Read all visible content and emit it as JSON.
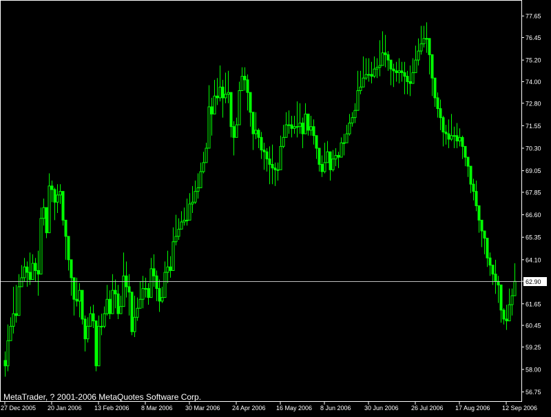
{
  "colors": {
    "background": "#000000",
    "frame": "#ffffff",
    "candle": "#00ff00",
    "text": "#ffffff",
    "current_price_line": "#c0c0c0",
    "current_price_tag_bg": "#ffffff",
    "current_price_tag_text": "#000000"
  },
  "footer": {
    "copyright": "MetaTrader, ? 2001-2006 MetaQuotes Software Corp."
  },
  "chart_data": {
    "type": "candlestick",
    "grid": false,
    "ylim": [
      56.2,
      78.5
    ],
    "y_ticks": [
      "77.65",
      "76.45",
      "75.20",
      "74.00",
      "72.80",
      "71.55",
      "70.30",
      "69.05",
      "67.85",
      "66.60",
      "65.35",
      "64.10",
      "62.90",
      "61.65",
      "60.45",
      "59.25",
      "58.00",
      "56.75"
    ],
    "x_ticks": [
      {
        "label": "27 Dec 2005",
        "index": 0
      },
      {
        "label": "20 Jan 2006",
        "index": 17
      },
      {
        "label": "13 Feb 2006",
        "index": 34
      },
      {
        "label": "8 Mar 2006",
        "index": 51
      },
      {
        "label": "30 Mar 2006",
        "index": 67
      },
      {
        "label": "24 Apr 2006",
        "index": 84
      },
      {
        "label": "16 May 2006",
        "index": 100
      },
      {
        "label": "8 Jun 2006",
        "index": 116
      },
      {
        "label": "30 Jun 2006",
        "index": 132
      },
      {
        "label": "26 Jul 2006",
        "index": 149
      },
      {
        "label": "17 Aug 2006",
        "index": 165
      },
      {
        "label": "12 Sep 2006",
        "index": 182
      }
    ],
    "current_price": "62.90",
    "series": [
      {
        "close": [
          58.2,
          59.6,
          60.4,
          61.1,
          61.0,
          62.6,
          63.1,
          63.7,
          63.4,
          63.0,
          63.9,
          63.5,
          63.3,
          66.4,
          67.0,
          65.6,
          68.2,
          68.0,
          67.3,
          67.7,
          67.9,
          66.3,
          65.4,
          64.1,
          63.1,
          61.9,
          61.8,
          62.4,
          60.8,
          59.7,
          60.4,
          61.1,
          60.7,
          58.2,
          60.4,
          60.4,
          61.1,
          61.9,
          61.1,
          62.4,
          62.2,
          61.1,
          61.5,
          63.2,
          62.6,
          62.3,
          60.1,
          60.9,
          61.4,
          61.9,
          62.5,
          62.5,
          62.0,
          63.6,
          63.2,
          62.5,
          61.8,
          62.0,
          63.4,
          63.7,
          63.5,
          65.1,
          65.4,
          65.8,
          66.2,
          66.3,
          66.3,
          67.2,
          67.3,
          67.9,
          68.1,
          69.0,
          69.5,
          70.3,
          72.6,
          72.2,
          73.2,
          73.1,
          73.7,
          73.1,
          73.3,
          73.4,
          71.5,
          70.9,
          71.6,
          73.5,
          74.3,
          74.1,
          73.4,
          72.3,
          71.1,
          71.3,
          70.9,
          70.2,
          70.1,
          69.7,
          69.4,
          69.2,
          69.1,
          69.1,
          70.4,
          70.9,
          71.6,
          71.6,
          71.4,
          71.5,
          71.5,
          71.7,
          71.1,
          72.2,
          71.3,
          71.5,
          71.0,
          70.3,
          69.4,
          69.0,
          69.5,
          70.1,
          69.1,
          69.7,
          69.9,
          69.8,
          70.6,
          70.6,
          71.1,
          71.7,
          72.0,
          72.4,
          73.5,
          73.7,
          74.2,
          74.4,
          74.4,
          74.3,
          74.7,
          74.8,
          74.9,
          75.6,
          75.5,
          75.2,
          74.7,
          74.6,
          74.5,
          74.6,
          74.5,
          74.3,
          74.0,
          73.9,
          74.5,
          75.2,
          75.7,
          76.1,
          76.4,
          76.4,
          75.5,
          74.2,
          73.1,
          72.5,
          72.0,
          71.2,
          71.1,
          70.8,
          71.0,
          71.0,
          70.7,
          70.9,
          70.4,
          69.8,
          69.3,
          68.3,
          67.9,
          67.1,
          66.3,
          65.7,
          65.3,
          64.2,
          63.8,
          63.3,
          62.9,
          62.7,
          61.3,
          60.8,
          60.7,
          61.6,
          62.1,
          62.9
        ],
        "high": [
          59.0,
          60.5,
          60.9,
          62.6,
          62.7,
          63.3,
          63.8,
          64.2,
          64.0,
          64.5,
          64.4,
          64.2,
          64.6,
          67.0,
          67.5,
          66.9,
          68.9,
          68.5,
          68.1,
          68.3,
          68.3,
          67.5,
          66.2,
          64.6,
          64.1,
          62.4,
          63.1,
          62.8,
          61.9,
          61.0,
          60.9,
          61.5,
          61.6,
          59.5,
          61.0,
          61.1,
          61.5,
          62.7,
          62.4,
          63.3,
          63.0,
          62.7,
          62.1,
          64.5,
          64.0,
          63.3,
          61.6,
          62.1,
          62.0,
          62.9,
          63.2,
          63.1,
          62.8,
          64.2,
          64.4,
          63.5,
          63.0,
          62.6,
          64.0,
          64.6,
          64.3,
          65.9,
          66.6,
          66.4,
          66.8,
          67.0,
          67.5,
          67.8,
          68.2,
          68.5,
          68.9,
          69.5,
          70.1,
          70.6,
          73.8,
          73.1,
          74.1,
          74.2,
          74.9,
          74.1,
          74.5,
          74.6,
          73.1,
          71.8,
          72.0,
          74.0,
          74.8,
          74.8,
          74.4,
          73.3,
          71.7,
          72.3,
          71.4,
          71.2,
          70.6,
          70.3,
          70.4,
          70.5,
          69.5,
          69.5,
          71.0,
          71.6,
          72.3,
          72.4,
          72.1,
          72.1,
          72.9,
          72.8,
          72.0,
          72.8,
          72.0,
          72.1,
          71.9,
          70.8,
          70.0,
          69.9,
          70.6,
          70.7,
          70.1,
          70.2,
          70.3,
          70.1,
          70.9,
          71.1,
          71.6,
          72.2,
          72.3,
          72.8,
          74.6,
          74.6,
          75.4,
          75.3,
          75.3,
          75.1,
          75.4,
          75.3,
          76.3,
          76.8,
          76.6,
          75.7,
          75.1,
          75.0,
          75.1,
          75.3,
          75.1,
          75.1,
          74.6,
          74.9,
          75.3,
          76.0,
          76.4,
          77.1,
          77.1,
          77.3,
          76.2,
          75.3,
          74.0,
          73.4,
          73.0,
          72.1,
          71.6,
          71.9,
          72.2,
          71.5,
          71.7,
          71.4,
          71.0,
          70.2,
          69.7,
          68.7,
          68.6,
          68.5,
          66.7,
          66.2,
          65.6,
          64.9,
          64.5,
          63.7,
          64.1,
          63.2,
          62.4,
          61.4,
          61.6,
          62.5,
          62.5,
          63.9
        ],
        "low": [
          57.6,
          57.9,
          59.6,
          60.0,
          60.6,
          61.9,
          62.6,
          62.9,
          62.6,
          62.7,
          63.0,
          62.9,
          62.1,
          65.1,
          66.0,
          65.3,
          67.2,
          67.3,
          66.3,
          66.7,
          67.2,
          66.0,
          64.1,
          63.5,
          62.1,
          61.0,
          61.5,
          60.9,
          60.5,
          59.0,
          59.5,
          60.5,
          60.3,
          57.9,
          59.5,
          59.9,
          60.3,
          61.0,
          60.8,
          61.9,
          61.4,
          60.8,
          61.2,
          62.1,
          62.0,
          61.0,
          59.9,
          59.8,
          60.7,
          61.5,
          61.4,
          62.0,
          61.6,
          62.6,
          62.6,
          61.8,
          61.2,
          61.7,
          62.6,
          62.8,
          63.1,
          64.2,
          64.9,
          65.2,
          65.8,
          66.0,
          66.0,
          66.5,
          66.7,
          67.2,
          67.5,
          68.2,
          68.9,
          69.6,
          71.3,
          71.0,
          72.3,
          72.7,
          72.9,
          72.0,
          72.8,
          72.8,
          70.9,
          69.9,
          70.9,
          72.8,
          73.7,
          73.5,
          72.4,
          71.5,
          70.2,
          70.8,
          70.3,
          69.7,
          69.1,
          69.0,
          68.3,
          68.3,
          68.2,
          68.5,
          69.5,
          70.3,
          71.1,
          71.1,
          70.9,
          71.1,
          70.9,
          71.1,
          70.3,
          71.8,
          71.0,
          71.0,
          70.5,
          69.7,
          69.0,
          68.7,
          68.9,
          69.6,
          68.5,
          69.0,
          69.3,
          69.2,
          69.8,
          69.9,
          70.8,
          71.0,
          71.5,
          71.7,
          72.5,
          73.3,
          73.7,
          74.1,
          74.0,
          73.9,
          74.2,
          74.2,
          74.3,
          74.9,
          74.8,
          74.6,
          73.8,
          73.7,
          74.0,
          73.9,
          74.0,
          73.3,
          73.3,
          73.2,
          74.1,
          74.5,
          74.9,
          75.5,
          75.9,
          75.6,
          74.4,
          73.2,
          72.6,
          72.0,
          71.3,
          70.4,
          70.5,
          70.3,
          70.7,
          70.3,
          70.3,
          70.4,
          69.7,
          69.3,
          68.7,
          67.8,
          67.4,
          66.8,
          65.6,
          64.8,
          64.4,
          63.7,
          63.2,
          62.7,
          62.2,
          61.7,
          60.6,
          60.5,
          60.2,
          61.0,
          61.0,
          62.4
        ]
      }
    ]
  }
}
